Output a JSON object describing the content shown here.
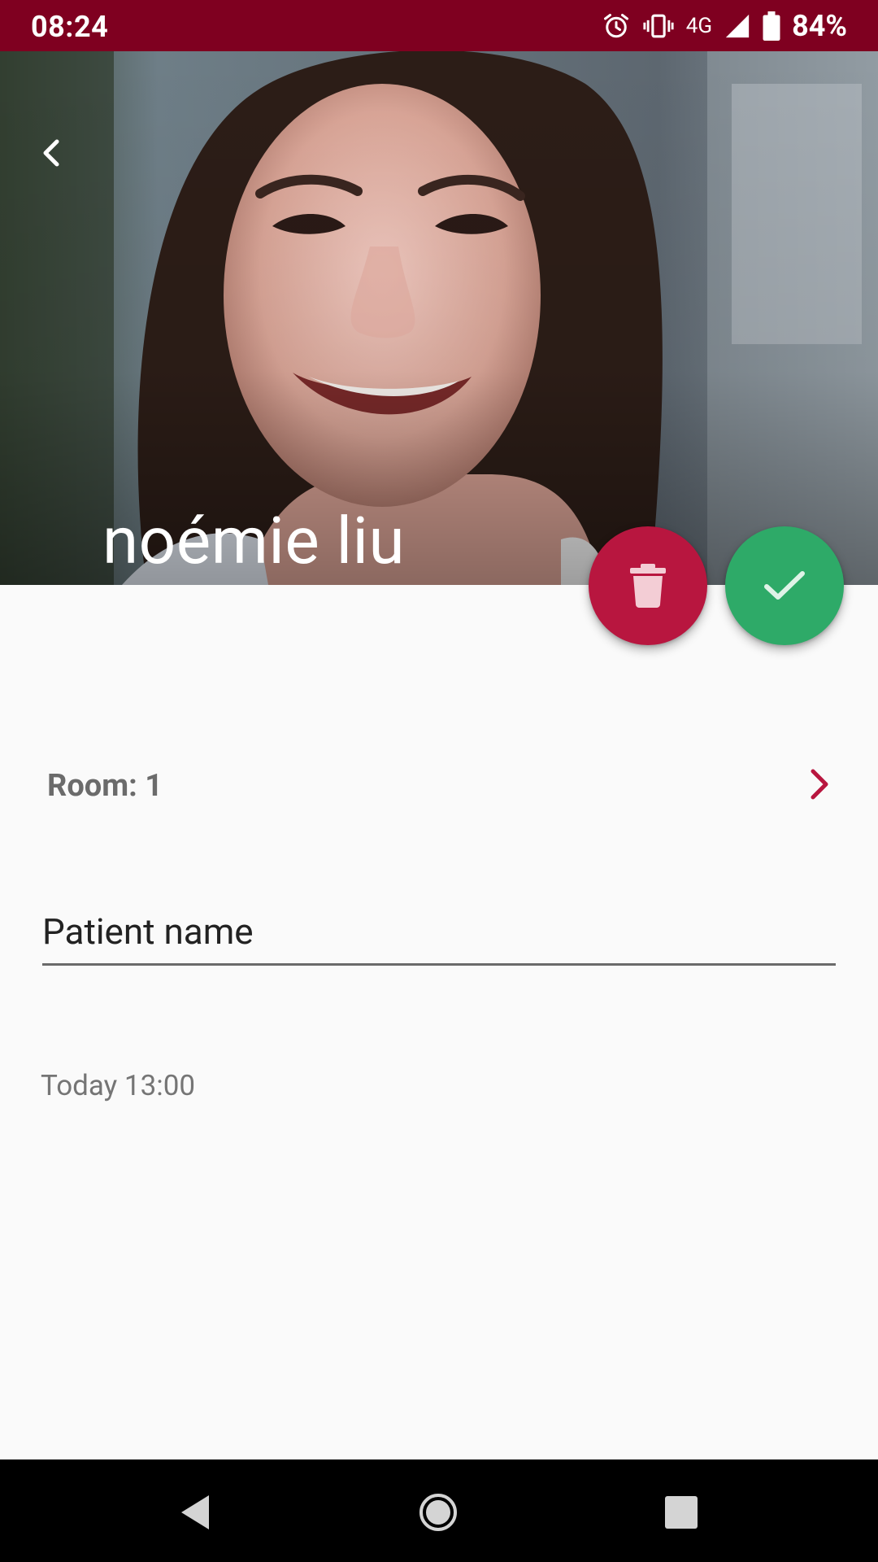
{
  "status_bar": {
    "time": "08:24",
    "network": "4G",
    "battery_percent": "84%",
    "background_color": "#7f0020"
  },
  "header": {
    "title": "noémie liu",
    "back_icon": "chevron-left-icon"
  },
  "actions": {
    "delete_icon": "trash-icon",
    "delete_color": "#b8163f",
    "confirm_icon": "check-icon",
    "confirm_color": "#2eaa68"
  },
  "room": {
    "label": "Room: 1",
    "chevron_icon": "chevron-right-icon",
    "chevron_color": "#b8163f"
  },
  "patient_field": {
    "placeholder": "Patient name",
    "value": ""
  },
  "appointment": {
    "datetime": "Today 13:00"
  },
  "nav_bar": {
    "back_icon": "nav-back-icon",
    "home_icon": "nav-home-icon",
    "recents_icon": "nav-recents-icon"
  }
}
